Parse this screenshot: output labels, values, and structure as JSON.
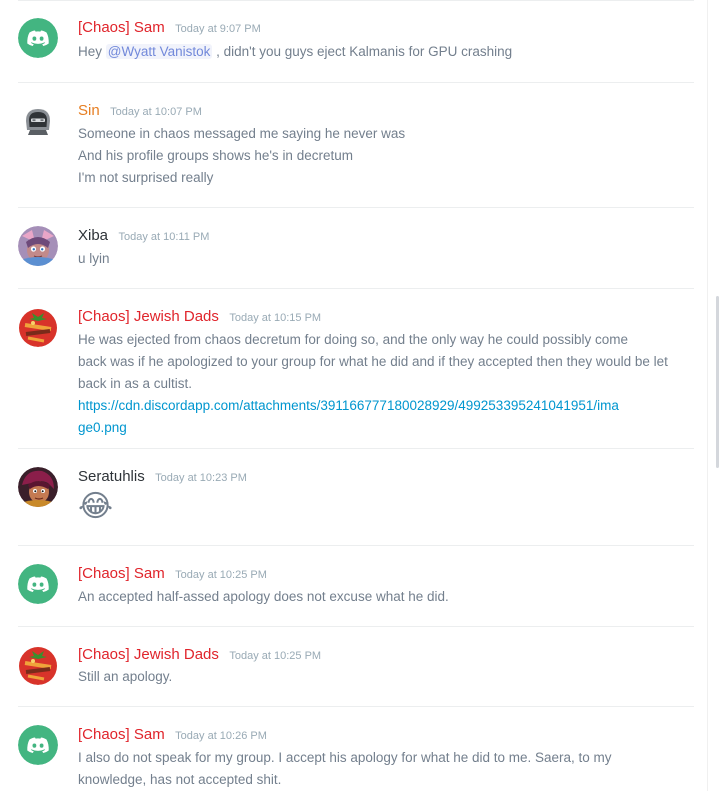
{
  "colors": {
    "chaos": "#e0242b",
    "sin": "#e67e22",
    "plain": "#2e3338",
    "discord_green": "#43b581",
    "link": "#0096cf",
    "mention": "#7289da"
  },
  "messages": [
    {
      "author": "[Chaos] Sam",
      "timestamp": "Today at 9:07 PM",
      "avatar": "discord-logo-icon",
      "content": {
        "pre_mention": "Hey ",
        "mention": "@Wyatt Vanistok",
        "post_mention": " , didn't you guys eject Kalmanis for GPU crashing"
      }
    },
    {
      "author": "Sin",
      "timestamp": "Today at 10:07 PM",
      "avatar": "helmet-avatar-icon",
      "lines": [
        "Someone in chaos messaged me saying he never was",
        "And his profile groups shows he's in decretum",
        "I'm not surprised really"
      ]
    },
    {
      "author": "Xiba",
      "timestamp": "Today at 10:11 PM",
      "avatar": "anime-avatar-icon",
      "lines": [
        "u lyin"
      ]
    },
    {
      "author": "[Chaos] Jewish Dads",
      "timestamp": "Today at 10:15 PM",
      "avatar": "tomato-avatar-icon",
      "lines": [
        "He was ejected from chaos decretum for doing so, and the only way he could possibly come",
        "back was if he apologized to your group for what he did and if they accepted then they would be let",
        "back in as a cultist."
      ],
      "link_lines": [
        "https://cdn.discordapp.com/attachments/391166777180028929/499253395241041951/ima",
        "ge0.png"
      ]
    },
    {
      "author": "Seratuhlis",
      "timestamp": "Today at 10:23 PM",
      "avatar": "dark-anime-avatar-icon",
      "emoji": "😂"
    },
    {
      "author": "[Chaos] Sam",
      "timestamp": "Today at 10:25 PM",
      "avatar": "discord-logo-icon",
      "lines": [
        "An accepted half-assed apology does not excuse what he did."
      ]
    },
    {
      "author": "[Chaos] Jewish Dads",
      "timestamp": "Today at 10:25 PM",
      "avatar": "tomato-avatar-icon",
      "lines": [
        "Still an apology."
      ]
    },
    {
      "author": "[Chaos] Sam",
      "timestamp": "Today at 10:26 PM",
      "avatar": "discord-logo-icon",
      "lines": [
        "I also do not speak for my group. I accept his apology for what he did to me. Saera, to my",
        "knowledge, has not accepted shit."
      ]
    }
  ]
}
